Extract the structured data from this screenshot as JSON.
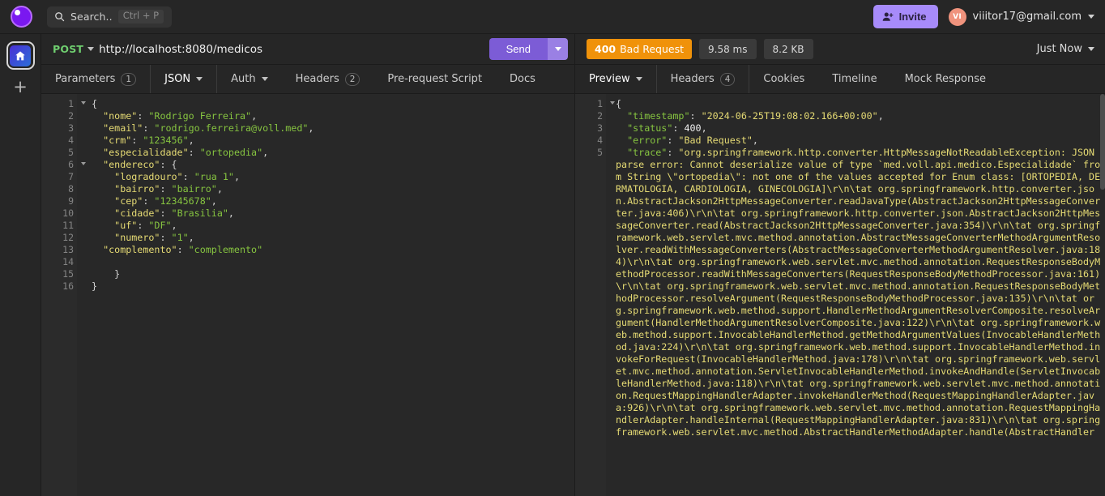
{
  "header": {
    "logo": "thunder-client-logo",
    "search": {
      "icon": "search-icon",
      "label": "Search..",
      "shortcut": "Ctrl + P"
    },
    "invite": {
      "icon": "add-person-icon",
      "label": "Invite"
    },
    "account": {
      "initials": "VI",
      "email": "viiitor17@gmail.com"
    }
  },
  "rail": {
    "home_icon": "home-icon",
    "add_label": "+"
  },
  "request": {
    "method": "POST",
    "url": "http://localhost:8080/medicos",
    "send_label": "Send",
    "tabs": [
      {
        "label": "Parameters",
        "badge": "1",
        "active": false
      },
      {
        "label": "JSON",
        "badge": "",
        "active": true,
        "dropdown": true
      },
      {
        "label": "Auth",
        "badge": "",
        "active": false,
        "dropdown": true
      },
      {
        "label": "Headers",
        "badge": "2",
        "active": false
      },
      {
        "label": "Pre-request Script",
        "badge": "",
        "active": false
      },
      {
        "label": "Docs",
        "badge": "",
        "active": false
      }
    ],
    "body_lines": [
      {
        "n": 1,
        "fold": true,
        "indent": 0,
        "text": "{",
        "type": "punct"
      },
      {
        "n": 2,
        "fold": false,
        "indent": 1,
        "key": "nome",
        "value": "Rodrigo Ferreira",
        "comma": true
      },
      {
        "n": 3,
        "fold": false,
        "indent": 1,
        "key": "email",
        "value": "rodrigo.ferreira@voll.med",
        "comma": true
      },
      {
        "n": 4,
        "fold": false,
        "indent": 1,
        "key": "crm",
        "value": "123456",
        "comma": true
      },
      {
        "n": 5,
        "fold": false,
        "indent": 1,
        "key": "especialidade",
        "value": "ortopedia",
        "comma": true
      },
      {
        "n": 6,
        "fold": true,
        "indent": 1,
        "key": "endereco",
        "open": "{"
      },
      {
        "n": 7,
        "fold": false,
        "indent": 2,
        "key": "logradouro",
        "value": "rua 1",
        "comma": true
      },
      {
        "n": 8,
        "fold": false,
        "indent": 2,
        "key": "bairro",
        "value": "bairro",
        "comma": true
      },
      {
        "n": 9,
        "fold": false,
        "indent": 2,
        "key": "cep",
        "value": "12345678",
        "comma": true
      },
      {
        "n": 10,
        "fold": false,
        "indent": 2,
        "key": "cidade",
        "value": "Brasilia",
        "comma": true
      },
      {
        "n": 11,
        "fold": false,
        "indent": 2,
        "key": "uf",
        "value": "DF",
        "comma": true
      },
      {
        "n": 12,
        "fold": false,
        "indent": 2,
        "key": "numero",
        "value": "1",
        "comma": true
      },
      {
        "n": 13,
        "fold": false,
        "indent": 1,
        "key": "complemento",
        "value": "complemento",
        "comma": false
      },
      {
        "n": 14,
        "fold": false,
        "indent": 0,
        "text": "",
        "type": "blank"
      },
      {
        "n": 15,
        "fold": false,
        "indent": 2,
        "text": "}",
        "type": "punct"
      },
      {
        "n": 16,
        "fold": false,
        "indent": 0,
        "text": "}",
        "type": "punct"
      }
    ]
  },
  "response": {
    "status_code": "400",
    "status_text": "Bad Request",
    "time": "9.58 ms",
    "size": "8.2 KB",
    "timing_label": "Just Now",
    "tabs": [
      {
        "label": "Preview",
        "badge": "",
        "active": true,
        "dropdown": true
      },
      {
        "label": "Headers",
        "badge": "4",
        "active": false
      },
      {
        "label": "Cookies",
        "badge": "",
        "active": false
      },
      {
        "label": "Timeline",
        "badge": "",
        "active": false
      },
      {
        "label": "Mock Response",
        "badge": "",
        "active": false
      }
    ],
    "line_numbers": [
      1,
      2,
      3,
      4,
      5
    ],
    "body": {
      "open_brace": "{",
      "fields": [
        {
          "key": "timestamp",
          "value": "2024-06-25T19:08:02.166+00:00",
          "kind": "string",
          "comma": true
        },
        {
          "key": "status",
          "value": "400",
          "kind": "number",
          "comma": true
        },
        {
          "key": "error",
          "value": "Bad Request",
          "kind": "string",
          "comma": true
        }
      ],
      "trace_key": "trace",
      "trace_value": "org.springframework.http.converter.HttpMessageNotReadableException: JSON parse error: Cannot deserialize value of type `med.voll.api.medico.Especialidade` from String \\\"ortopedia\\\": not one of the values accepted for Enum class: [ORTOPEDIA, DERMATOLOGIA, CARDIOLOGIA, GINECOLOGIA]\\r\\n\\tat org.springframework.http.converter.json.AbstractJackson2HttpMessageConverter.readJavaType(AbstractJackson2HttpMessageConverter.java:406)\\r\\n\\tat org.springframework.http.converter.json.AbstractJackson2HttpMessageConverter.read(AbstractJackson2HttpMessageConverter.java:354)\\r\\n\\tat org.springframework.web.servlet.mvc.method.annotation.AbstractMessageConverterMethodArgumentResolver.readWithMessageConverters(AbstractMessageConverterMethodArgumentResolver.java:184)\\r\\n\\tat org.springframework.web.servlet.mvc.method.annotation.RequestResponseBodyMethodProcessor.readWithMessageConverters(RequestResponseBodyMethodProcessor.java:161)\\r\\n\\tat org.springframework.web.servlet.mvc.method.annotation.RequestResponseBodyMethodProcessor.resolveArgument(RequestResponseBodyMethodProcessor.java:135)\\r\\n\\tat org.springframework.web.method.support.HandlerMethodArgumentResolverComposite.resolveArgument(HandlerMethodArgumentResolverComposite.java:122)\\r\\n\\tat org.springframework.web.method.support.InvocableHandlerMethod.getMethodArgumentValues(InvocableHandlerMethod.java:224)\\r\\n\\tat org.springframework.web.method.support.InvocableHandlerMethod.invokeForRequest(InvocableHandlerMethod.java:178)\\r\\n\\tat org.springframework.web.servlet.mvc.method.annotation.ServletInvocableHandlerMethod.invokeAndHandle(ServletInvocableHandlerMethod.java:118)\\r\\n\\tat org.springframework.web.servlet.mvc.method.annotation.RequestMappingHandlerAdapter.invokeHandlerMethod(RequestMappingHandlerAdapter.java:926)\\r\\n\\tat org.springframework.web.servlet.mvc.method.annotation.RequestMappingHandlerAdapter.handleInternal(RequestMappingHandlerAdapter.java:831)\\r\\n\\tat org.springframework.web.servlet.mvc.method.AbstractHandlerMethodAdapter.handle(AbstractHandler"
    }
  },
  "colors": {
    "accent_purple": "#7c5cd6",
    "invite_purple": "#a78bfa",
    "status_orange": "#f0920a",
    "method_green": "#6fce6f",
    "json_key_yellow": "#e6db74",
    "json_string_green": "#86c440",
    "background": "#262626",
    "editor_background": "#282828"
  }
}
